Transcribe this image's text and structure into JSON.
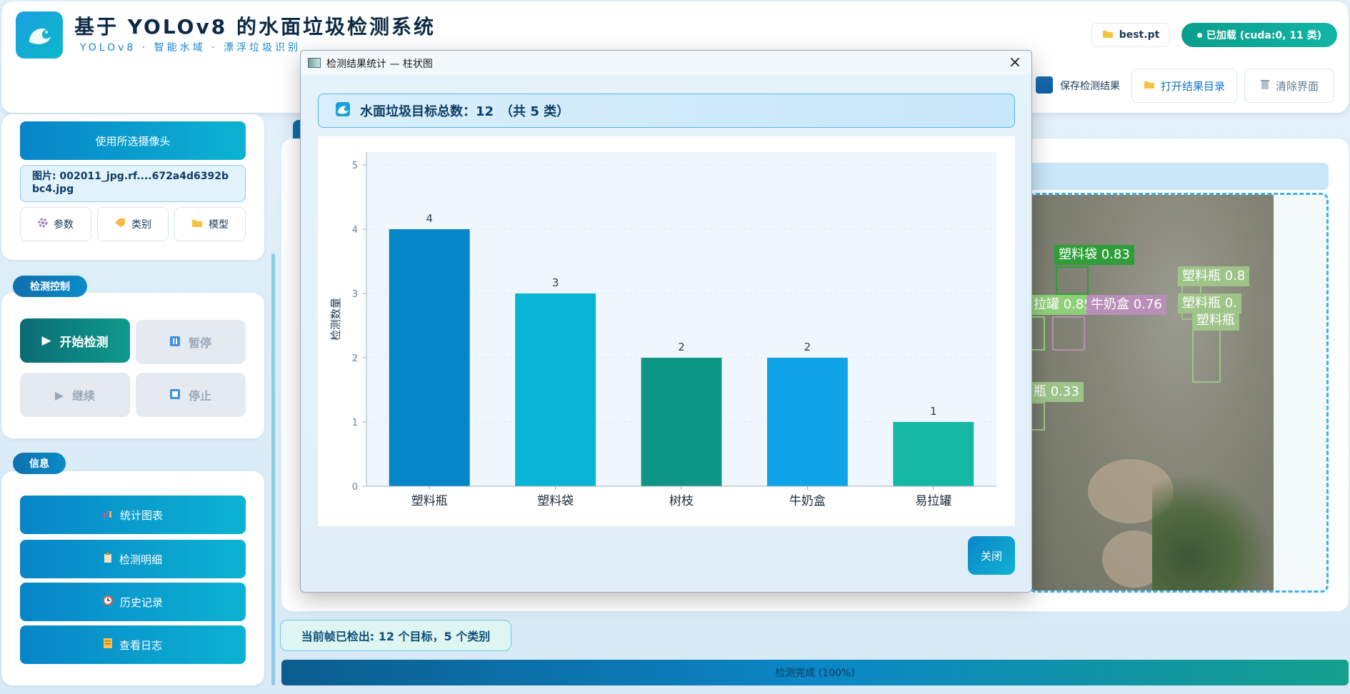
{
  "header": {
    "title": "基于 YOLOv8 的水面垃圾检测系统",
    "subtitle": "YOLOv8 · 智能水域 · 漂浮垃圾识别",
    "model_file": "best.pt",
    "status": "已加载 (cuda:0, 11 类)",
    "save_results_label": "保存检测结果",
    "open_dir_label": "打开结果目录",
    "clear_label": "清除界面",
    "logo_icon": "wave-icon"
  },
  "source": {
    "use_camera_label": "使用所选摄像头",
    "image_info": "图片: 002011_jpg.rf....672a4d6392bbc4.jpg",
    "buttons": [
      {
        "label": "参数",
        "icon": "gear-icon"
      },
      {
        "label": "类别",
        "icon": "tag-icon"
      },
      {
        "label": "模型",
        "icon": "folder-icon"
      }
    ]
  },
  "control": {
    "section_label": "检测控制",
    "start_label": "开始检测",
    "pause_label": "暂停",
    "resume_label": "继续",
    "stop_label": "停止"
  },
  "info": {
    "section_label": "信息",
    "buttons": [
      {
        "label": "统计图表",
        "icon": "bar-chart-icon"
      },
      {
        "label": "检测明细",
        "icon": "clipboard-icon"
      },
      {
        "label": "历史记录",
        "icon": "clock-icon"
      },
      {
        "label": "查看日志",
        "icon": "log-icon"
      }
    ]
  },
  "detections": [
    {
      "label": "塑料袋 0.83",
      "color": "#2f9e3a"
    },
    {
      "label": "塑料瓶 0.8",
      "color": "#9ec48a"
    },
    {
      "label": "塑料瓶 0.",
      "color": "#9ec48a"
    },
    {
      "label": "塑料瓶",
      "color": "#9ec48a"
    },
    {
      "label": "拉罐 0.85",
      "color": "#8fcf7a"
    },
    {
      "label": "牛奶盒 0.76",
      "color": "#b78fb8"
    },
    {
      "label": "瓶 0.33",
      "color": "#9ec48a"
    }
  ],
  "status_bar": {
    "message": "当前帧已检出: 12 个目标，5 个类别",
    "progress_text": "检测完成 (100%)",
    "progress": 1.0
  },
  "dialog": {
    "title": "检测结果统计 — 柱状图",
    "summary": "水面垃圾目标总数：12　（共 5 类）",
    "close_label": "关闭",
    "close_glyph": "×"
  },
  "chart_data": {
    "type": "bar",
    "categories": [
      "塑料瓶",
      "塑料袋",
      "树枝",
      "牛奶盒",
      "易拉罐"
    ],
    "values": [
      4,
      3,
      2,
      2,
      1
    ],
    "colors": [
      "#0485c8",
      "#08b5d4",
      "#0d9585",
      "#0fa3e8",
      "#14b8a4"
    ],
    "ylabel": "检测数量",
    "xlabel": "",
    "ylim": [
      0,
      5
    ],
    "yticks": [
      0,
      1,
      2,
      3,
      4,
      5
    ],
    "grid": true,
    "data_labels": true
  }
}
